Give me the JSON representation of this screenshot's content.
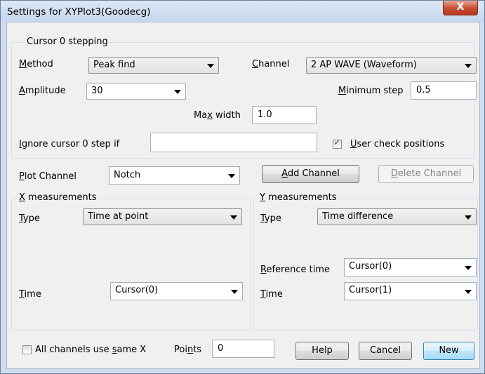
{
  "window": {
    "title": "Settings for XYPlot3(Goodecg)",
    "close_glyph": "X"
  },
  "cursor_group": {
    "title": "Cursor 0 stepping",
    "method": {
      "label_u": "M",
      "label_rest": "ethod",
      "value": "Peak find"
    },
    "channel": {
      "label_u": "C",
      "label_rest": "hannel",
      "value": "2 AP WAVE (Waveform)"
    },
    "amplitude": {
      "label_u": "A",
      "label_rest": "mplitude",
      "value": "30"
    },
    "minimum_step": {
      "label_u": "M",
      "label_rest": "inimum step",
      "value": "0.5"
    },
    "max_width": {
      "label_pre": "Ma",
      "label_u": "x",
      "label_rest": " width",
      "value": "1.0"
    },
    "ignore": {
      "label_u": "I",
      "label_rest": "gnore cursor 0 step if",
      "value": ""
    },
    "user_check": {
      "label_u": "U",
      "label_rest": "ser check positions",
      "checked": true
    }
  },
  "plot_channel": {
    "label_u": "P",
    "label_rest": "lot Channel",
    "value": "Notch",
    "add_button": {
      "label_u": "A",
      "label_rest": "dd Channel"
    },
    "delete_button": {
      "label_u": "D",
      "label_rest": "elete Channel"
    }
  },
  "x_group": {
    "title_u": "X",
    "title_rest": " measurements",
    "type_label_u": "T",
    "type_label_rest": "ype",
    "type_value": "Time at point",
    "time_label_u": "T",
    "time_label_rest": "ime",
    "time_value": "Cursor(0)"
  },
  "y_group": {
    "title_u": "Y",
    "title_rest": " measurements",
    "type_label_u": "T",
    "type_label_rest": "ype",
    "type_value": "Time difference",
    "ref_label_u": "R",
    "ref_label_rest": "eference time",
    "ref_value": "Cursor(0)",
    "time_label_u": "T",
    "time_label_rest": "ime",
    "time_value": "Cursor(1)"
  },
  "bottom": {
    "same_x": {
      "label_pre": "All channels use ",
      "label_u": "s",
      "label_rest": "ame X",
      "checked": false
    },
    "points": {
      "label_pre": "Poi",
      "label_u": "n",
      "label_rest": "ts",
      "value": "0"
    },
    "help_label": "Help",
    "cancel_label": "Cancel",
    "new_label": "New"
  },
  "colors": {
    "titlebar": "#cfdcee",
    "close": "#c94d36",
    "face": "#f0f0f0",
    "default_button": "#bee6fd"
  }
}
